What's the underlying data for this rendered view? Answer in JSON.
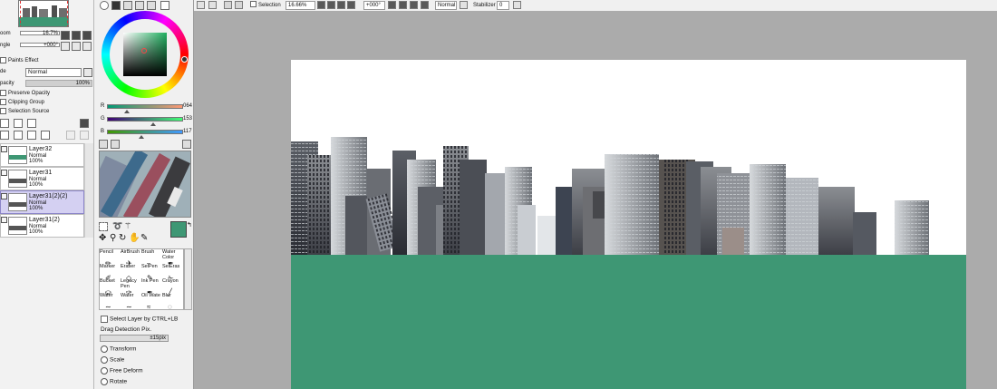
{
  "toolbar": {
    "selection_label": "Selection",
    "zoom_value": "16.66%",
    "angle_value": "+000°",
    "blend_mode": "Normal",
    "stabilizer_label": "Stabilizer",
    "stabilizer_value": "0"
  },
  "navigator": {
    "zoom_label": "oom",
    "zoom_value": "16.7%",
    "angle_label": "ngle",
    "angle_value": "+000°"
  },
  "layer_props": {
    "paints_effect": "Paints Effect",
    "mode_label": "de",
    "mode_value": "Normal",
    "opacity_label": "pacity",
    "opacity_value": "100%",
    "preserve_opacity": "Preserve Opacity",
    "clipping_group": "Clipping Group",
    "selection_source": "Selection Source"
  },
  "layers": [
    {
      "name": "Layer32",
      "mode": "Normal",
      "opacity": "100%"
    },
    {
      "name": "Layer31",
      "mode": "Normal",
      "opacity": "100%"
    },
    {
      "name": "Layer31(2)(2)",
      "mode": "Normal",
      "opacity": "100%"
    },
    {
      "name": "Layer31(2)",
      "mode": "Normal",
      "opacity": "100%"
    }
  ],
  "color": {
    "r_label": "R",
    "r_value": "064",
    "g_label": "G",
    "g_value": "153",
    "b_label": "B",
    "b_value": "117",
    "primary": "#3e9774",
    "secondary": "#ffffff"
  },
  "tools": [
    {
      "label": "Pencil",
      "icon": "pencil-icon"
    },
    {
      "label": "AirBrush",
      "icon": "airbrush-icon"
    },
    {
      "label": "Brush",
      "icon": "brush-icon"
    },
    {
      "label": "Water Color",
      "icon": "watercolor-icon"
    },
    {
      "label": "Marker",
      "icon": "marker-icon"
    },
    {
      "label": "Eraser",
      "icon": "eraser-icon"
    },
    {
      "label": "SelPen",
      "icon": "selpen-icon"
    },
    {
      "label": "SelEras",
      "icon": "seleras-icon"
    },
    {
      "label": "Bucket",
      "icon": "bucket-icon"
    },
    {
      "label": "Legacy Pen",
      "icon": "legacy-pen-icon"
    },
    {
      "label": "Ink Pen",
      "icon": "ink-pen-icon"
    },
    {
      "label": "Crayon",
      "icon": "crayon-icon"
    },
    {
      "label": "Water",
      "icon": "water-icon"
    },
    {
      "label": "Water",
      "icon": "water-icon"
    },
    {
      "label": "Oil Wate",
      "icon": "oil-water-icon"
    },
    {
      "label": "Blur",
      "icon": "blur-icon"
    }
  ],
  "options": {
    "select_layer": "Select Layer by CTRL+LB",
    "drag_detection": "Drag Detection Pix.",
    "drag_value": "±15pix",
    "transform": "Transform",
    "scale": "Scale",
    "free_deform": "Free Deform",
    "rotate": "Rotate"
  }
}
